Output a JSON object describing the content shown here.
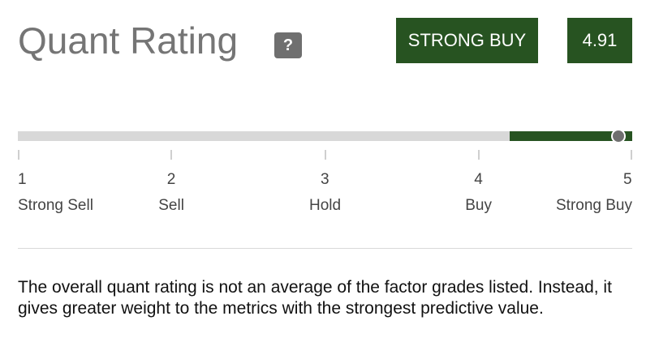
{
  "header": {
    "title": "Quant Rating",
    "help_label": "?",
    "rating_label": "STRONG BUY",
    "rating_score": "4.91"
  },
  "scale": {
    "min": 1,
    "max": 5,
    "value": 4.91,
    "filled_from": 4.2,
    "fill_color": "#275321",
    "track_color": "#d8d8d8",
    "ticks": [
      {
        "number": "1",
        "label": "Strong Sell"
      },
      {
        "number": "2",
        "label": "Sell"
      },
      {
        "number": "3",
        "label": "Hold"
      },
      {
        "number": "4",
        "label": "Buy"
      },
      {
        "number": "5",
        "label": "Strong Buy"
      }
    ]
  },
  "note": "The overall quant rating is not an average of the factor grades listed. Instead, it gives greater weight to the metrics with the strongest predictive value."
}
